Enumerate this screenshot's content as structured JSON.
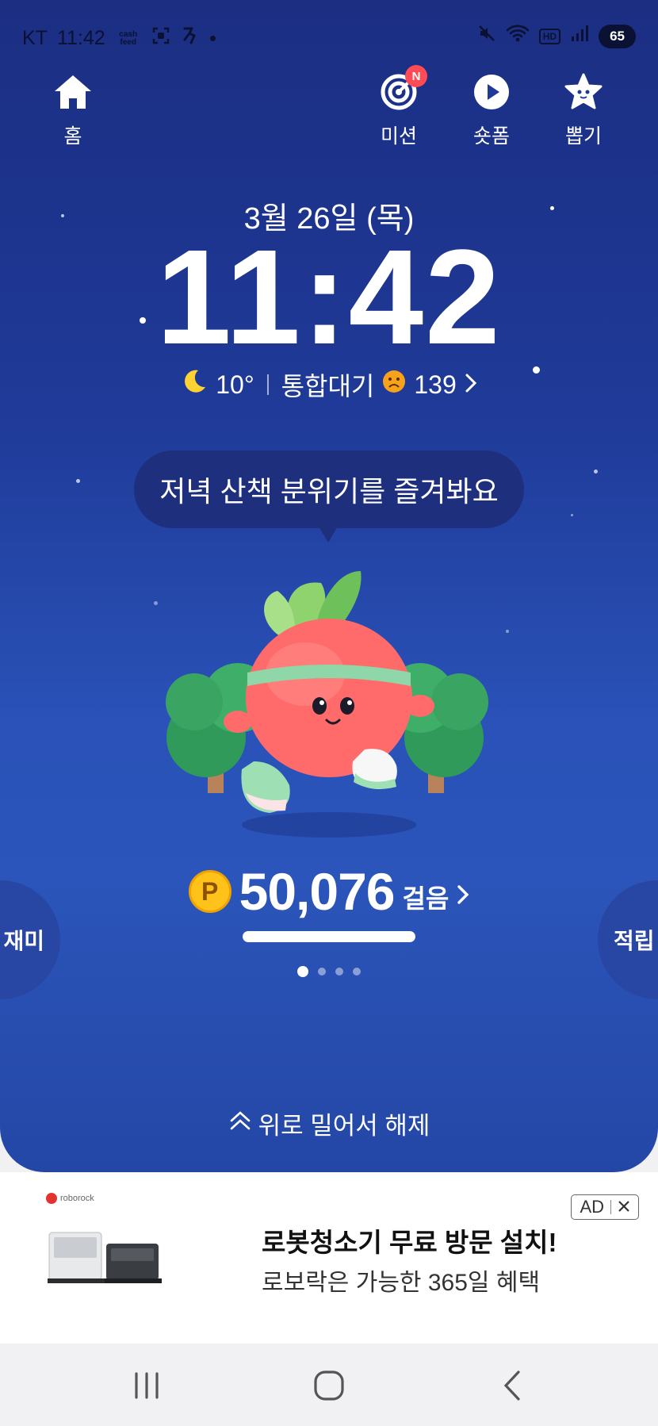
{
  "status_bar": {
    "carrier": "KT",
    "time": "11:42",
    "cash_label": "cash feed",
    "battery": "65"
  },
  "top_nav": [
    {
      "label": "홈",
      "icon": "home-icon"
    },
    {
      "label": "미션",
      "icon": "target-icon",
      "badge": "N"
    },
    {
      "label": "숏폼",
      "icon": "play-icon"
    },
    {
      "label": "뽑기",
      "icon": "star-icon"
    }
  ],
  "date": "3월 26일 (목)",
  "clock": "11:42",
  "weather": {
    "icon": "moon-icon",
    "temperature": "10°",
    "air_label": "통합대기",
    "air_icon": "sad-face-icon",
    "air_value": "139"
  },
  "speech_bubble": "저녁 산책 분위기를 즐겨봐요",
  "steps": {
    "coin_label": "P",
    "value": "50,076",
    "unit": "걸음",
    "progress_fraction": 1.0
  },
  "pager": {
    "count": 4,
    "active": 0
  },
  "side_buttons": {
    "left": "재미",
    "right": "적립"
  },
  "unlock_hint": "위로 밀어서 해제",
  "ad": {
    "brand": "roborock",
    "tag": "AD",
    "headline": "로봇청소기 무료 방문 설치!",
    "subtext": "로보락은 가능한 365일 혜택"
  },
  "colors": {
    "background_top": "#1b2e82",
    "background_bottom": "#2b55ba",
    "coin": "#ffc21a",
    "badge": "#ff4b55"
  }
}
